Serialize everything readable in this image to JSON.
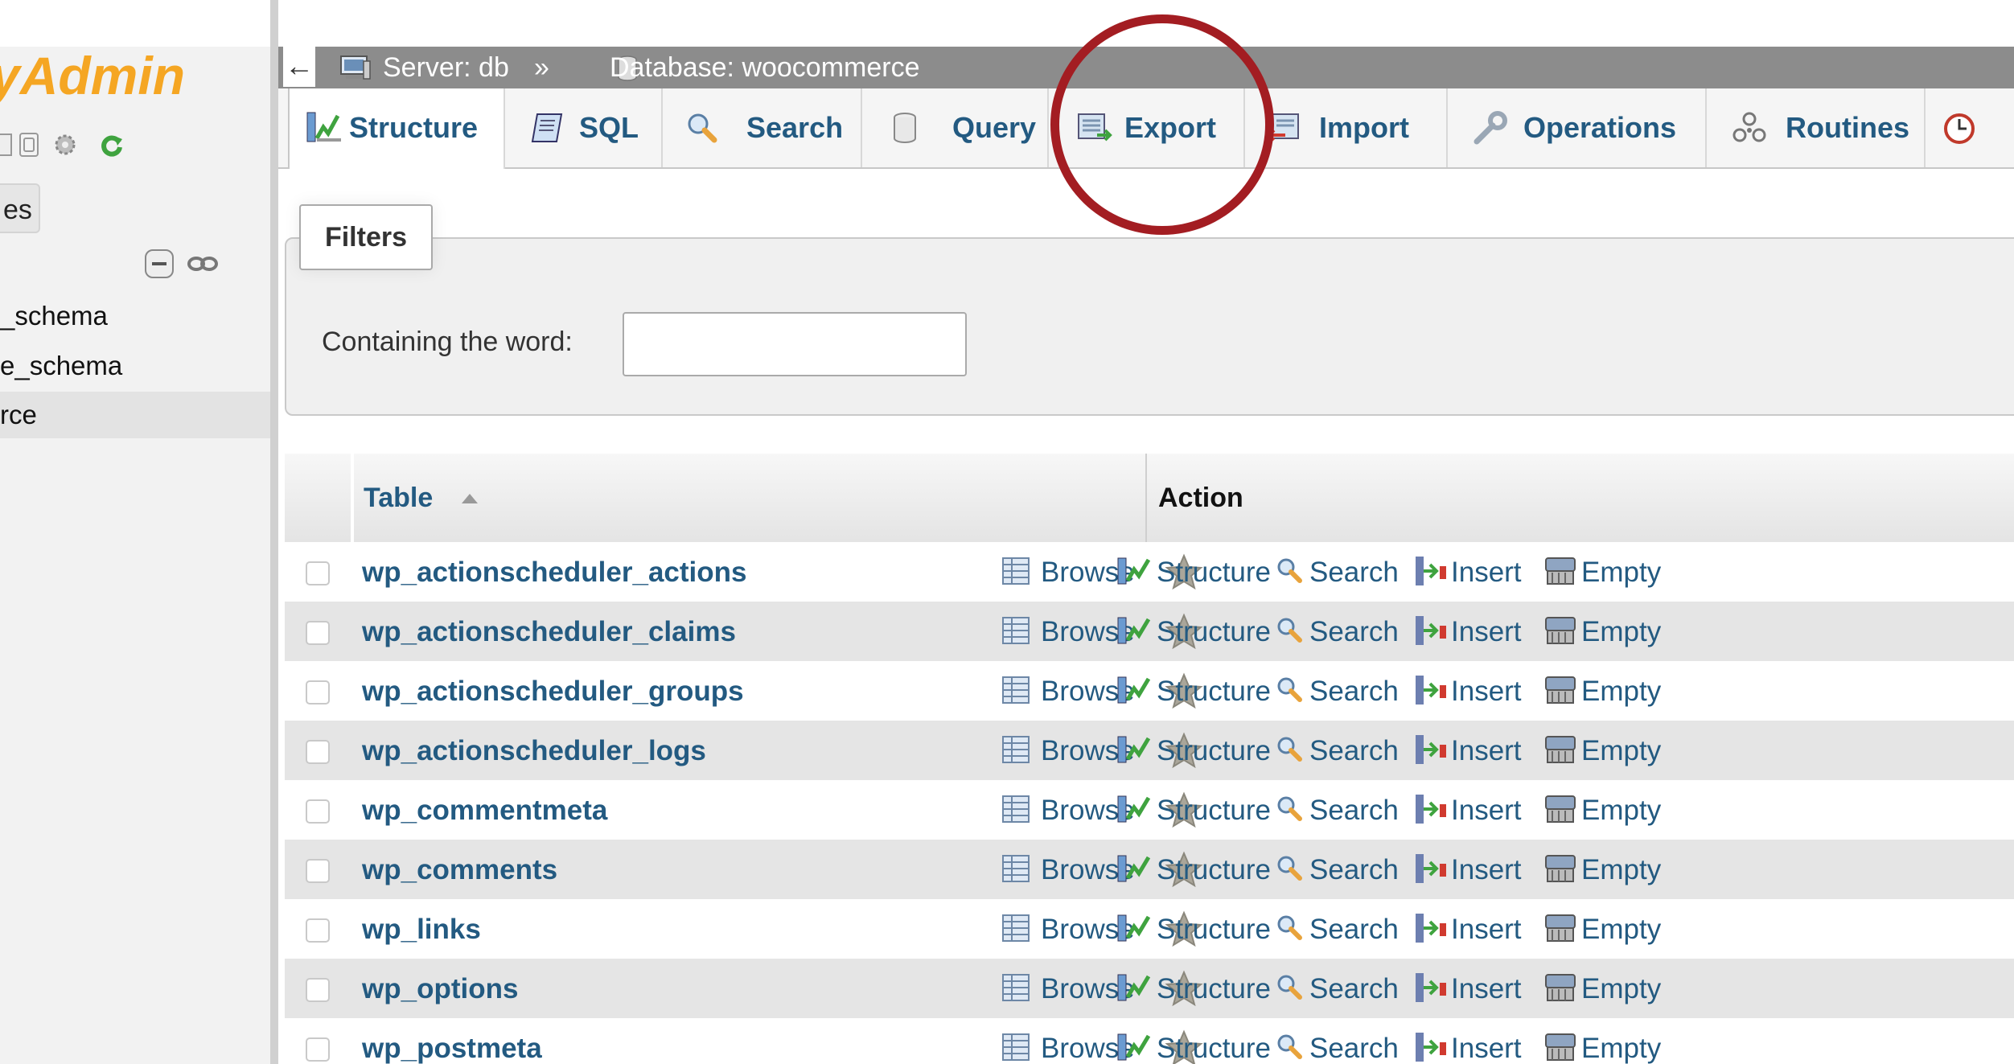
{
  "sidebar": {
    "logo_text": "yAdmin",
    "db_button_label": "es",
    "tree_items": [
      "_schema",
      "e_schema",
      "rce"
    ]
  },
  "breadcrumb": {
    "back_label": "←",
    "server": "Server: db",
    "separator": "»",
    "database": "Database: woocommerce"
  },
  "tabs": [
    {
      "label": "Structure",
      "icon": "structure-icon",
      "active": true
    },
    {
      "label": "SQL",
      "icon": "sql-icon"
    },
    {
      "label": "Search",
      "icon": "search-icon"
    },
    {
      "label": "Query",
      "icon": "query-icon"
    },
    {
      "label": "Export",
      "icon": "export-icon"
    },
    {
      "label": "Import",
      "icon": "import-icon"
    },
    {
      "label": "Operations",
      "icon": "wrench-icon"
    },
    {
      "label": "Routines",
      "icon": "routines-icon"
    }
  ],
  "filters": {
    "legend": "Filters",
    "label": "Containing the word:",
    "value": ""
  },
  "table": {
    "col_table": "Table",
    "col_action": "Action",
    "action_labels": {
      "browse": "Browse",
      "structure": "Structure",
      "search": "Search",
      "insert": "Insert",
      "empty": "Empty"
    },
    "rows": [
      "wp_actionscheduler_actions",
      "wp_actionscheduler_claims",
      "wp_actionscheduler_groups",
      "wp_actionscheduler_logs",
      "wp_commentmeta",
      "wp_comments",
      "wp_links",
      "wp_options",
      "wp_postmeta"
    ]
  },
  "colors": {
    "link": "#235a81",
    "logo": "#f5a623",
    "highlight": "#a31d22",
    "crumbbar": "#8c8c8c"
  }
}
